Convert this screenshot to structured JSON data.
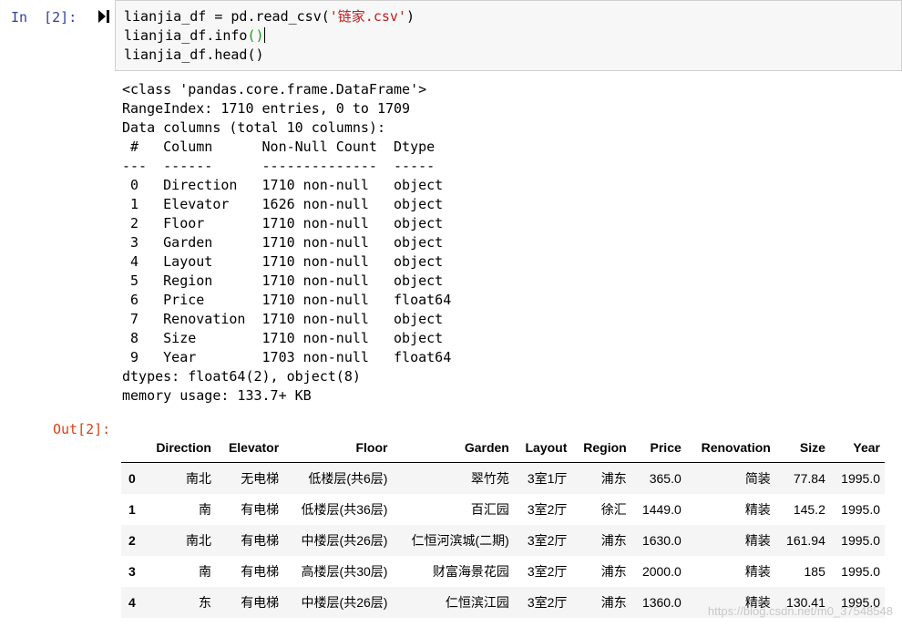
{
  "cell": {
    "in_prompt": "In  [2]:",
    "code": {
      "line1_pre": "lianjia_df = pd.read_csv(",
      "line1_str": "'链家.csv'",
      "line1_post": ")",
      "line2_pre": "lianjia_df.info",
      "line2_parens": "()",
      "line3": "lianjia_df.head()"
    },
    "stdout": [
      "<class 'pandas.core.frame.DataFrame'>",
      "RangeIndex: 1710 entries, 0 to 1709",
      "Data columns (total 10 columns):",
      " #   Column      Non-Null Count  Dtype  ",
      "---  ------      --------------  -----  ",
      " 0   Direction   1710 non-null   object ",
      " 1   Elevator    1626 non-null   object ",
      " 2   Floor       1710 non-null   object ",
      " 3   Garden      1710 non-null   object ",
      " 4   Layout      1710 non-null   object ",
      " 5   Region      1710 non-null   object ",
      " 6   Price       1710 non-null   float64",
      " 7   Renovation  1710 non-null   object ",
      " 8   Size        1710 non-null   object ",
      " 9   Year        1703 non-null   float64",
      "dtypes: float64(2), object(8)",
      "memory usage: 133.7+ KB"
    ],
    "out_prompt": "Out[2]:"
  },
  "dataframe": {
    "columns": [
      "",
      "Direction",
      "Elevator",
      "Floor",
      "Garden",
      "Layout",
      "Region",
      "Price",
      "Renovation",
      "Size",
      "Year"
    ],
    "rows": [
      [
        "0",
        "南北",
        "无电梯",
        "低楼层(共6层)",
        "翠竹苑",
        "3室1厅",
        "浦东",
        "365.0",
        "简装",
        "77.84",
        "1995.0"
      ],
      [
        "1",
        "南",
        "有电梯",
        "低楼层(共36层)",
        "百汇园",
        "3室2厅",
        "徐汇",
        "1449.0",
        "精装",
        "145.2",
        "1995.0"
      ],
      [
        "2",
        "南北",
        "有电梯",
        "中楼层(共26层)",
        "仁恒河滨城(二期)",
        "3室2厅",
        "浦东",
        "1630.0",
        "精装",
        "161.94",
        "1995.0"
      ],
      [
        "3",
        "南",
        "有电梯",
        "高楼层(共30层)",
        "财富海景花园",
        "3室2厅",
        "浦东",
        "2000.0",
        "精装",
        "185",
        "1995.0"
      ],
      [
        "4",
        "东",
        "有电梯",
        "中楼层(共26层)",
        "仁恒滨江园",
        "3室2厅",
        "浦东",
        "1360.0",
        "精装",
        "130.41",
        "1995.0"
      ]
    ]
  },
  "watermark": "https://blog.csdn.net/m0_37548548"
}
